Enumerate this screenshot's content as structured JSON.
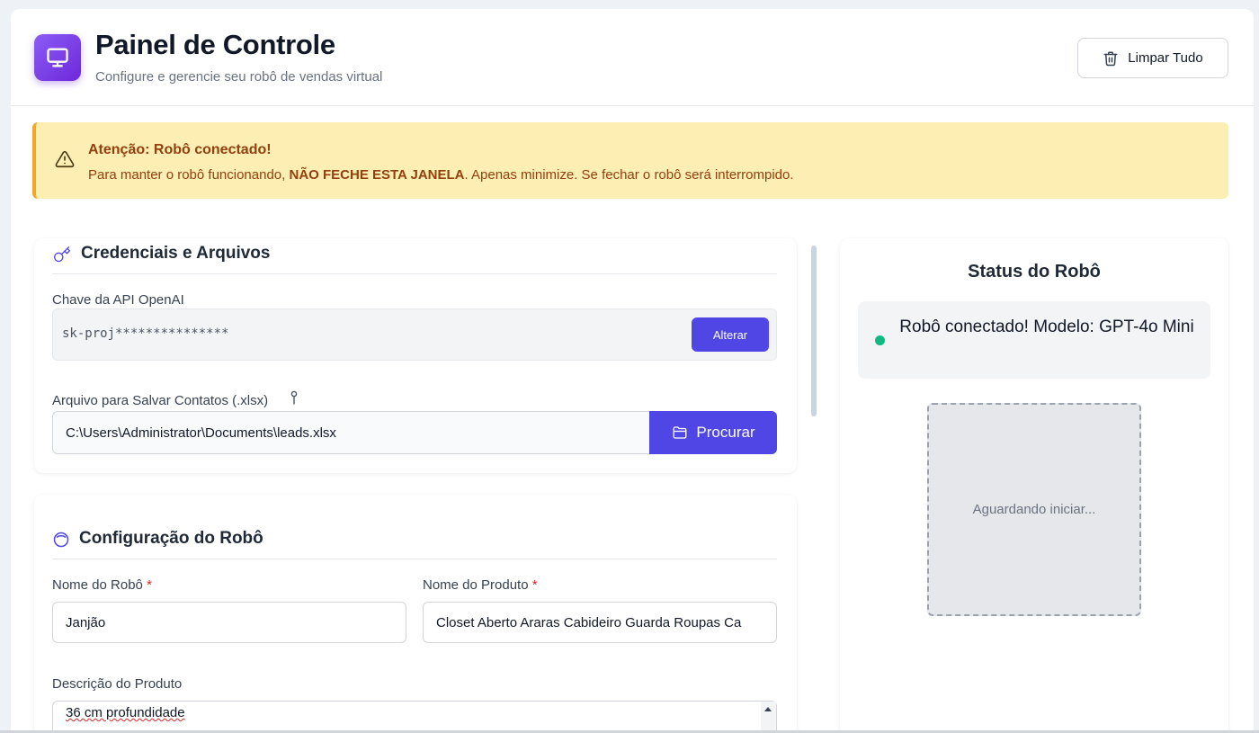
{
  "header": {
    "title": "Painel de Controle",
    "subtitle": "Configure e gerencie seu robô de vendas virtual",
    "clear_label": "Limpar Tudo"
  },
  "alert": {
    "title": "Atenção: Robô conectado!",
    "text_before": "Para manter o robô funcionando, ",
    "text_bold": "NÃO FECHE ESTA JANELA",
    "text_after": ". Apenas minimize. Se fechar o robô será interrompido."
  },
  "credentials": {
    "section_title": "Credenciais e Arquivos",
    "api_label": "Chave da API OpenAI",
    "api_value": "sk-proj***************",
    "change_label": "Alterar",
    "file_label": "Arquivo para Salvar Contatos (.xlsx)",
    "file_value": "C:\\Users\\Administrator\\Documents\\leads.xlsx",
    "browse_label": "Procurar"
  },
  "robot_config": {
    "section_title": "Configuração do Robô",
    "robot_name_label": "Nome do Robô",
    "robot_name_value": "Janjão",
    "product_name_label": "Nome do Produto",
    "product_name_value": "Closet Aberto Araras Cabideiro Guarda Roupas Ca",
    "description_label": "Descrição do Produto",
    "description_value": "36 cm profundidade",
    "required_mark": "*"
  },
  "status": {
    "title": "Status do Robô",
    "message": "Robô conectado! Modelo: GPT-4o Mini",
    "qr_placeholder": "Aguardando iniciar..."
  },
  "colors": {
    "primary": "#4f46e5",
    "warning_bg": "#fdeeb4",
    "warning_text": "#92400e",
    "status_online": "#10b981"
  },
  "icons": {
    "logo": "monitor-icon",
    "clear": "trash-icon",
    "alert": "warning-triangle-icon",
    "credentials": "key-icon",
    "file_info": "pin-icon",
    "browse": "folder-icon",
    "robot": "robot-head-icon"
  }
}
